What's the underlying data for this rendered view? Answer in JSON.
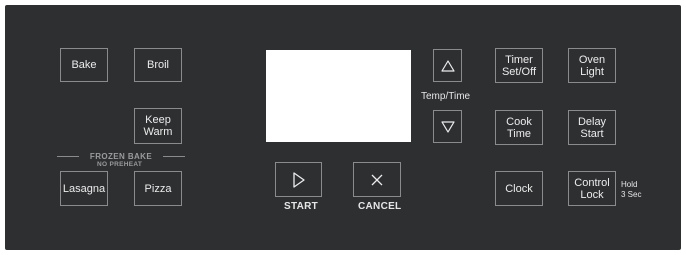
{
  "buttons": {
    "bake": "Bake",
    "broil": "Broil",
    "keep_warm": "Keep\nWarm",
    "lasagna": "Lasagna",
    "pizza": "Pizza",
    "timer": "Timer\nSet/Off",
    "oven_light": "Oven\nLight",
    "cook_time": "Cook\nTime",
    "delay_start": "Delay\nStart",
    "clock": "Clock",
    "control_lock": "Control\nLock"
  },
  "labels": {
    "frozen_bake": "FROZEN BAKE",
    "no_preheat": "NO PREHEAT",
    "temp_time": "Temp/Time",
    "start": "START",
    "cancel": "CANCEL",
    "hold": "Hold\n3 Sec"
  },
  "display": {
    "text": ""
  },
  "icons": {
    "up": "triangle-up-icon",
    "down": "triangle-down-icon",
    "start": "play-icon",
    "cancel": "close-icon"
  },
  "colors": {
    "panel": "#2e2f31",
    "border": "#8a8b8d",
    "text": "#e6e6e6",
    "display": "#ffffff"
  }
}
